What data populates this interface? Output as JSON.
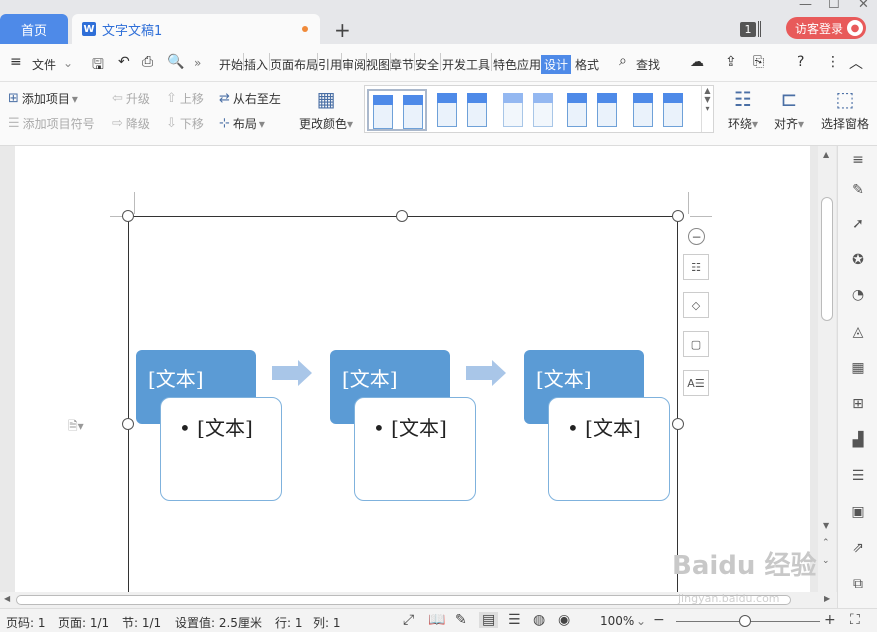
{
  "tabs": {
    "home": "首页",
    "doc": "文字文稿1",
    "new": "+",
    "window_count": "1",
    "login": "访客登录"
  },
  "menu": {
    "file": "文件",
    "items": [
      "开始",
      "插入",
      "页面布局",
      "引用",
      "审阅",
      "视图",
      "章节",
      "安全",
      "开发工具",
      "特色应用",
      "设计",
      "格式"
    ],
    "find": "查找"
  },
  "ribbon": {
    "add_item": "添加项目",
    "add_bullet": "添加项目符号",
    "promote": "升级",
    "demote": "降级",
    "move_up": "上移",
    "move_down": "下移",
    "rtl": "从右至左",
    "layout": "布局",
    "change_color": "更改颜色",
    "wrap": "环绕",
    "align": "对齐",
    "select_pane": "选择窗格"
  },
  "smartart": {
    "placeholder_head": "[文本]",
    "placeholder_bullet": "[文本]",
    "bullet_char": "•",
    "count": 3
  },
  "status": {
    "page_num": "页码: 1",
    "page": "页面: 1/1",
    "section": "节: 1/1",
    "setting": "设置值: 2.5厘米",
    "row": "行: 1",
    "col": "列: 1",
    "zoom": "100%"
  },
  "watermark": {
    "text": "Baidu 经验",
    "url": "jingyan.baidu.com"
  },
  "colors": {
    "accent": "#4e8ae8",
    "smartart_fill": "#5b9bd5",
    "login": "#e85a5a"
  }
}
